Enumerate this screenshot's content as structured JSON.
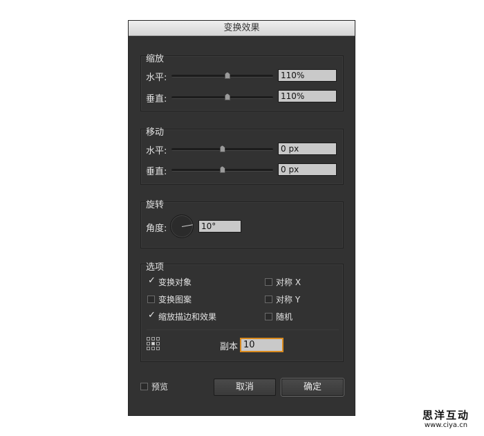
{
  "dialog": {
    "title": "变换效果"
  },
  "scale": {
    "title": "缩放",
    "horizontal": {
      "label": "水平:",
      "value": "110%",
      "slider_fraction": 0.55
    },
    "vertical": {
      "label": "垂直:",
      "value": "110%",
      "slider_fraction": 0.55
    }
  },
  "move": {
    "title": "移动",
    "horizontal": {
      "label": "水平:",
      "value": "0 px",
      "slider_fraction": 0.5
    },
    "vertical": {
      "label": "垂直:",
      "value": "0 px",
      "slider_fraction": 0.5
    }
  },
  "rotate": {
    "title": "旋转",
    "angle_label": "角度:",
    "angle_value": "10°"
  },
  "options": {
    "title": "选项",
    "transform_objects": {
      "label": "变换对象",
      "checked": true
    },
    "transform_patterns": {
      "label": "变换图案",
      "checked": false
    },
    "scale_strokes_effects": {
      "label": "缩放描边和效果",
      "checked": true
    },
    "reflect_x": {
      "label": "对称 X",
      "checked": false
    },
    "reflect_y": {
      "label": "对称 Y",
      "checked": false
    },
    "random": {
      "label": "随机",
      "checked": false
    },
    "copies_label": "副本",
    "copies_value": "10",
    "reference_point_icon": "reference-point-grid"
  },
  "footer": {
    "preview_label": "预览",
    "preview_checked": false,
    "cancel_label": "取消",
    "ok_label": "确定"
  },
  "watermark": {
    "title": "思洋互动",
    "url": "www.ciya.cn"
  },
  "colors": {
    "panel_bg": "#323232",
    "field_bg": "#c9c9c9",
    "focus_ring": "#d98a1e"
  }
}
